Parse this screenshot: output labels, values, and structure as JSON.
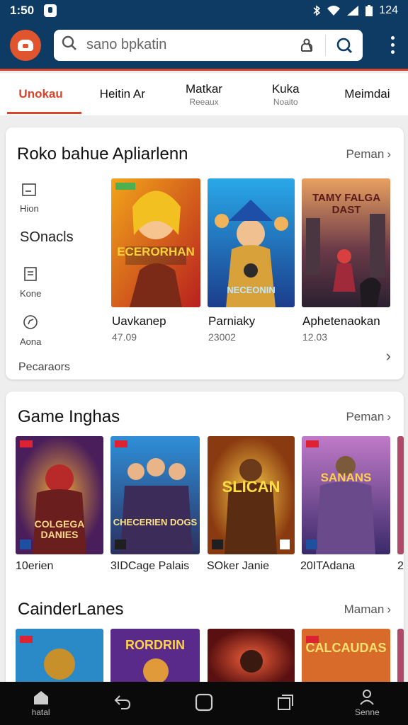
{
  "status": {
    "time": "1:50",
    "battery": "124"
  },
  "search": {
    "placeholder": "sano bpkatin"
  },
  "tabs": [
    {
      "label": "Unokau",
      "sub": ""
    },
    {
      "label": "Heitin Ar",
      "sub": ""
    },
    {
      "label": "Matkar",
      "sub": "Reeaux"
    },
    {
      "label": "Kuka",
      "sub": "Noaito"
    },
    {
      "label": "Meimdai",
      "sub": ""
    }
  ],
  "section1": {
    "title": "Roko bahue Apliarlenn",
    "more": "Peman",
    "side": [
      {
        "icon": "calendar-icon",
        "label": "Hion"
      },
      {
        "icon": "",
        "label": "SOnacls"
      },
      {
        "icon": "document-icon",
        "label": "Kone"
      },
      {
        "icon": "compass-icon",
        "label": "Aona"
      }
    ],
    "footer": "Pecaraors",
    "apps": [
      {
        "name": "Uavkanep",
        "size": "47.09",
        "art": "ECERORHAN"
      },
      {
        "name": "Parniaky",
        "size": "23002",
        "art": "NECEONIN"
      },
      {
        "name": "Aphetenaokan",
        "size": "12.03",
        "art": "TAMY FALGA DAST"
      }
    ]
  },
  "section2": {
    "title": "Game Inghas",
    "more": "Peman",
    "games": [
      {
        "name": "10erien",
        "art": "COLGEGA DANIES"
      },
      {
        "name": "3IDCage Palais",
        "art": "CHECERIEN DOGS"
      },
      {
        "name": "SOker Janie",
        "art": "SLICAN"
      },
      {
        "name": "20ITAdana",
        "art": "SANANS"
      },
      {
        "name": "2",
        "art": ""
      }
    ]
  },
  "section3": {
    "title": "CainderLanes",
    "more": "Maman",
    "games": [
      {
        "art": ""
      },
      {
        "art": "RORDRIN"
      },
      {
        "art": ""
      },
      {
        "art": "CALCAUDAS"
      }
    ]
  },
  "bottomnav": [
    {
      "icon": "home-icon",
      "label": "hatal"
    },
    {
      "icon": "back-icon",
      "label": ""
    },
    {
      "icon": "home-square-icon",
      "label": ""
    },
    {
      "icon": "recents-icon",
      "label": ""
    },
    {
      "icon": "person-icon",
      "label": "Senne"
    }
  ]
}
